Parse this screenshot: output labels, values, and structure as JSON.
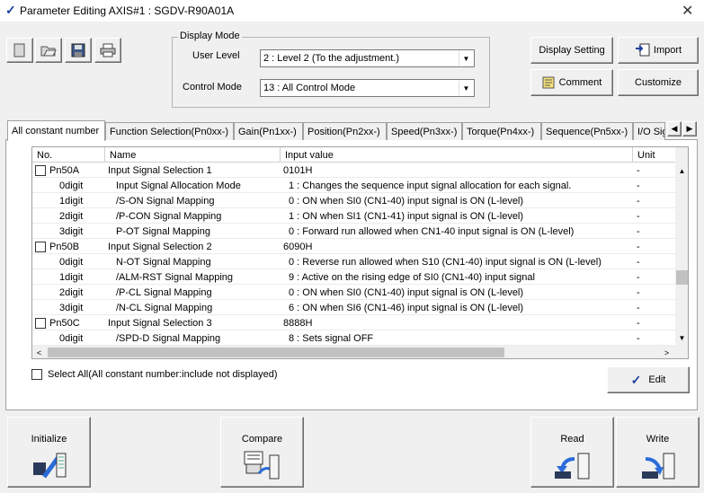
{
  "window": {
    "title": "Parameter Editing AXIS#1 : SGDV-R90A01A",
    "close": "✕"
  },
  "toolbar": {
    "icons": [
      "new-icon",
      "open-icon",
      "save-icon",
      "print-icon"
    ]
  },
  "display_mode": {
    "title": "Display Mode",
    "user_level_label": "User Level",
    "user_level_value": "2 : Level 2 (To the adjustment.)",
    "control_mode_label": "Control Mode",
    "control_mode_value": "13 : All Control Mode"
  },
  "actions": {
    "display_setting": "Display Setting",
    "import": "Import",
    "comment": "Comment",
    "customize": "Customize",
    "edit": "Edit",
    "initialize": "Initialize",
    "compare": "Compare",
    "read": "Read",
    "write": "Write"
  },
  "tabs": [
    "All constant number",
    "Function Selection(Pn0xx-)",
    "Gain(Pn1xx-)",
    "Position(Pn2xx-)",
    "Speed(Pn3xx-)",
    "Torque(Pn4xx-)",
    "Sequence(Pn5xx-)",
    "I/O Sign"
  ],
  "grid": {
    "columns": [
      "No.",
      "Name",
      "Input value",
      "Unit"
    ],
    "rows": [
      {
        "no": "Pn50A",
        "checkbox": true,
        "name": "Input Signal Selection 1",
        "value": "0101H",
        "unit": "-"
      },
      {
        "no": "0digit",
        "name": "Input Signal Allocation Mode",
        "value": "1 : Changes the sequence input signal allocation for each signal.",
        "unit": "-"
      },
      {
        "no": "1digit",
        "name": "/S-ON Signal Mapping",
        "value": "0 : ON when SI0 (CN1-40) input signal is ON (L-level)",
        "unit": "-"
      },
      {
        "no": "2digit",
        "name": "/P-CON Signal Mapping",
        "value": "1 : ON when SI1 (CN1-41) input signal is ON (L-level)",
        "unit": "-"
      },
      {
        "no": "3digit",
        "name": "P-OT Signal Mapping",
        "value": "0 : Forward run allowed when CN1-40 input signal is ON (L-level)",
        "unit": "-"
      },
      {
        "no": "Pn50B",
        "checkbox": true,
        "name": "Input Signal Selection 2",
        "value": "6090H",
        "unit": "-"
      },
      {
        "no": "0digit",
        "name": "N-OT Signal Mapping",
        "value": "0 : Reverse run allowed when S10 (CN1-40) input signal is ON (L-level)",
        "unit": "-"
      },
      {
        "no": "1digit",
        "name": "/ALM-RST Signal Mapping",
        "value": "9 : Active on the rising edge of SI0 (CN1-40) input signal",
        "unit": "-"
      },
      {
        "no": "2digit",
        "name": "/P-CL Signal Mapping",
        "value": "0 : ON when SI0 (CN1-40) input signal is ON (L-level)",
        "unit": "-"
      },
      {
        "no": "3digit",
        "name": "/N-CL Signal Mapping",
        "value": "6 : ON when SI6 (CN1-46) input signal is ON (L-level)",
        "unit": "-"
      },
      {
        "no": "Pn50C",
        "checkbox": true,
        "name": "Input Signal Selection 3",
        "value": "8888H",
        "unit": "-"
      },
      {
        "no": "0digit",
        "name": "/SPD-D Signal Mapping",
        "value": "8 : Sets signal OFF",
        "unit": "-"
      }
    ]
  },
  "select_all_label": "Select All(All constant number:include not displayed)"
}
